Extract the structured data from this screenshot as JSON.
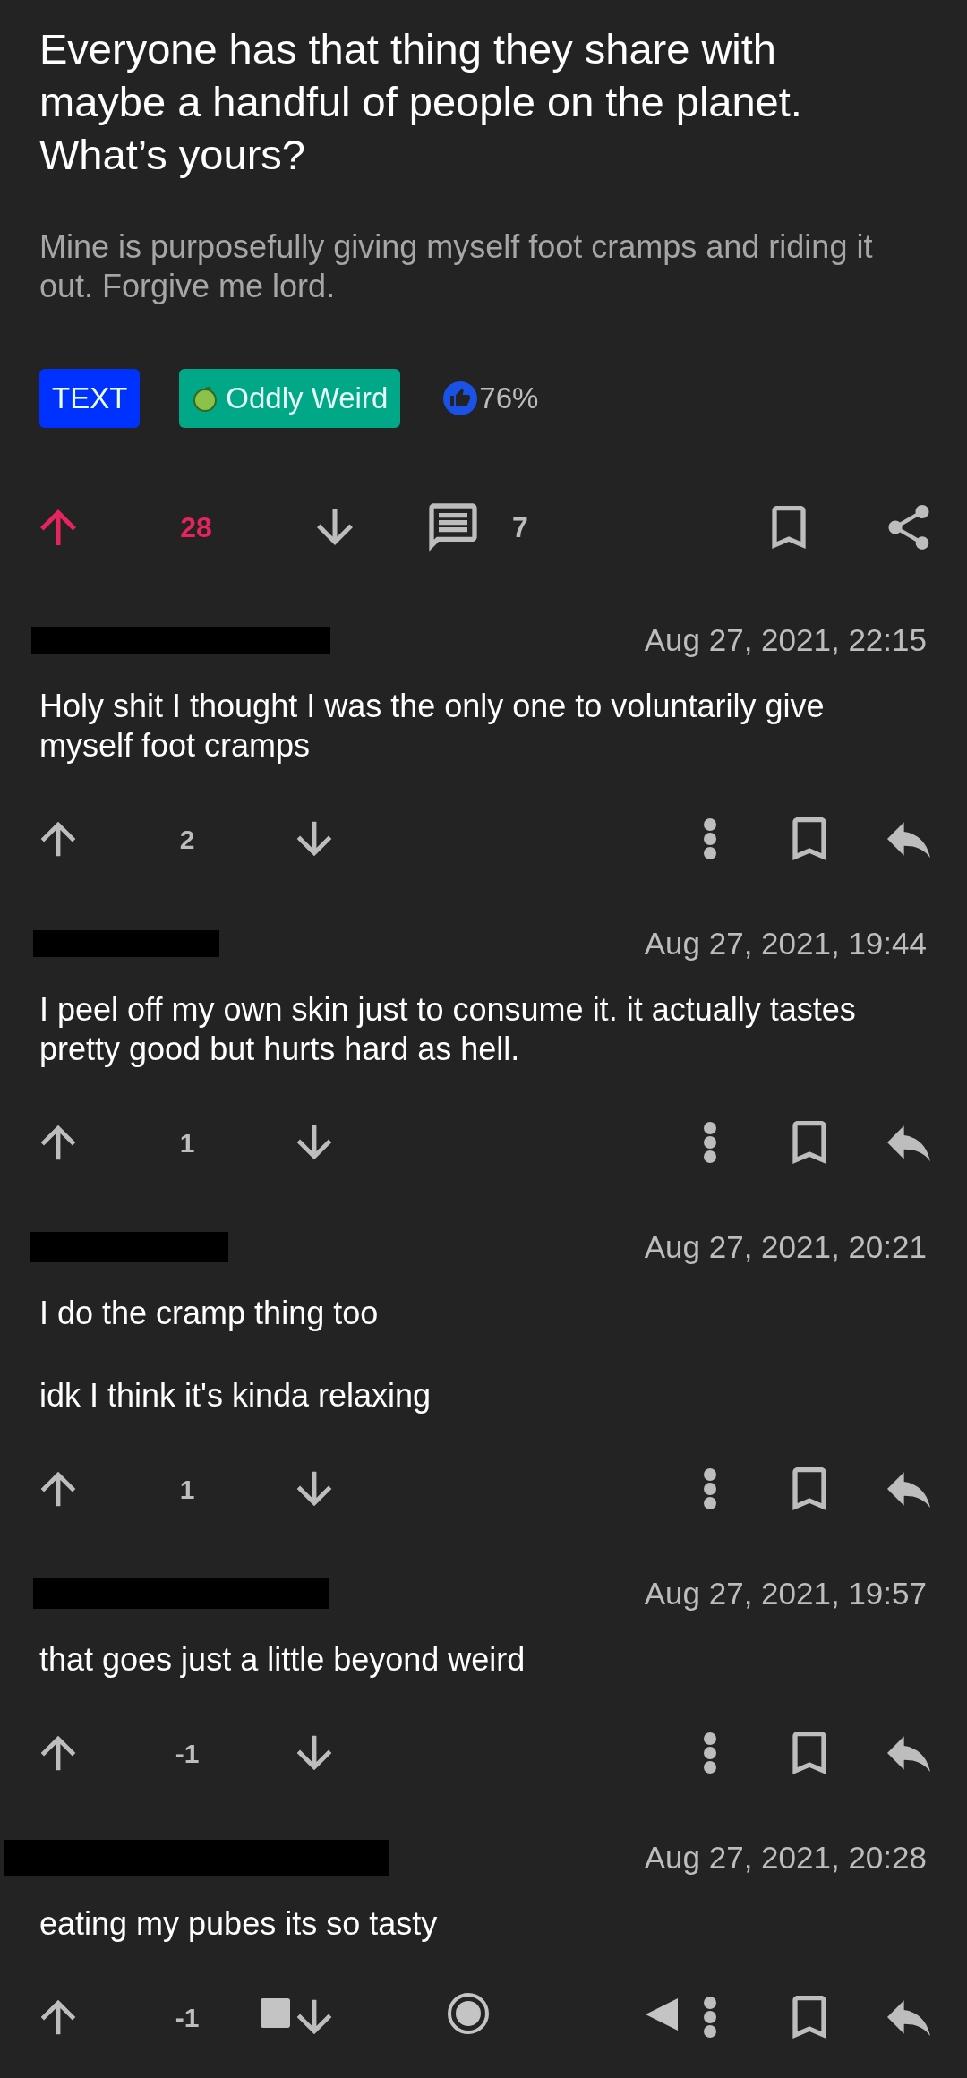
{
  "post": {
    "title": "Everyone has that thing they share with maybe a handful of people on the planet. What’s yours?",
    "body": "Mine is purposefully giving myself foot cramps and riding it out. Forgive me lord.",
    "tags": [
      {
        "label": "TEXT",
        "color": "#0032ff",
        "kind": "plain"
      },
      {
        "label": "Oddly Weird",
        "color": "#00a887",
        "kind": "flair"
      }
    ],
    "upvote_ratio": "76%",
    "score": "28",
    "upvoted": true,
    "comment_count": "7"
  },
  "comments": [
    {
      "date": "Aug 27, 2021, 22:15",
      "paragraphs": [
        "Holy shit I thought I was the only one to voluntarily give myself foot cramps"
      ],
      "score": "2",
      "upvoted": false
    },
    {
      "date": "Aug 27, 2021, 19:44",
      "paragraphs": [
        "I peel off my own skin just to consume it. it actually tastes pretty good but hurts hard as hell."
      ],
      "score": "1",
      "upvoted": false
    },
    {
      "date": "Aug 27, 2021, 20:21",
      "paragraphs": [
        "I do the cramp thing too",
        "idk I think it's kinda relaxing"
      ],
      "score": "1",
      "upvoted": false
    },
    {
      "date": "Aug 27, 2021, 19:57",
      "paragraphs": [
        "that goes just a little beyond weird"
      ],
      "score": "-1",
      "upvoted": false
    },
    {
      "date": "Aug 27, 2021, 20:28",
      "paragraphs": [
        "eating my pubes its so tasty"
      ],
      "score": "-1",
      "upvoted": false
    }
  ]
}
